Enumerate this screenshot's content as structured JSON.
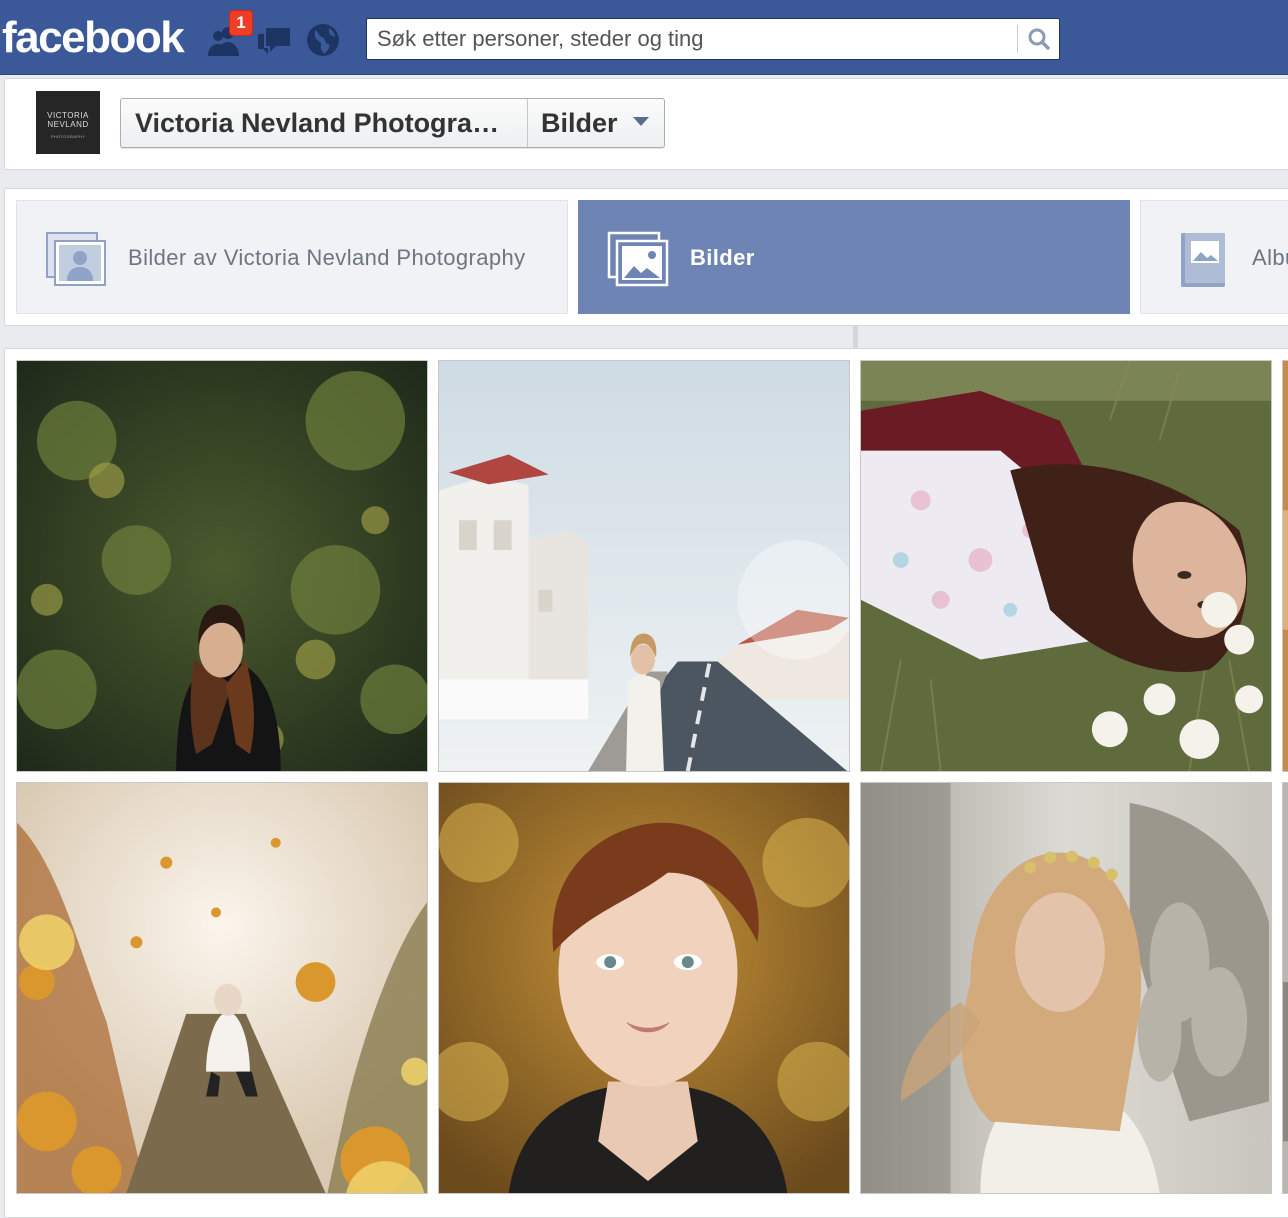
{
  "topbar": {
    "logo": "facebook",
    "notifications": {
      "friend_requests_badge": "1"
    },
    "jewels": [
      "friend-requests-icon",
      "messages-icon",
      "notifications-globe-icon"
    ],
    "search": {
      "placeholder": "Søk etter personer, steder og ting"
    }
  },
  "page_header": {
    "avatar_text": [
      "VICTORIA",
      "NEVLAND",
      "PHOTOGRAPHY"
    ],
    "page_name": "Victoria Nevland Photography",
    "section": "Bilder"
  },
  "tabs": [
    {
      "label": "Bilder av Victoria Nevland Photography",
      "icon": "tagged-photos-icon",
      "active": false
    },
    {
      "label": "Bilder",
      "icon": "photos-icon",
      "active": true
    },
    {
      "label": "Albumer",
      "icon": "album-icon",
      "active": false
    }
  ],
  "colors": {
    "brand_blue": "#3b5998",
    "active_tab": "#6d84b4",
    "badge_red": "#f03d25"
  },
  "photos": [
    {
      "id": "photo-1",
      "subject": "woman-in-greenery"
    },
    {
      "id": "photo-2",
      "subject": "woman-on-street"
    },
    {
      "id": "photo-3",
      "subject": "woman-lying-in-grass"
    },
    {
      "id": "photo-4",
      "subject": "crouching-in-autumn-leaves"
    },
    {
      "id": "photo-5",
      "subject": "portrait-short-hair"
    },
    {
      "id": "photo-6",
      "subject": "woman-with-angel-statue"
    }
  ]
}
